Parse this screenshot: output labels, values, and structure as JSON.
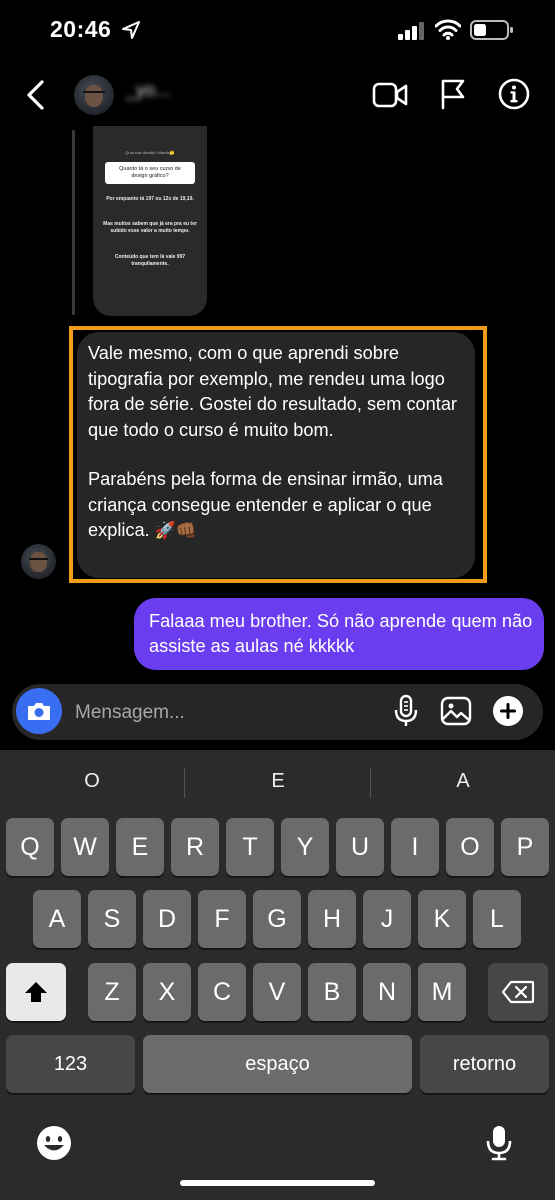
{
  "status_bar": {
    "time": "20:46"
  },
  "header": {
    "username": "_yo..."
  },
  "story_reply": {
    "title": "Qual sua dúvida? Manda🤔",
    "question": "Quanto tá o seu curso de design gráfico?",
    "answer_lines": [
      "Por enquanto tá 197 ou 12x de 19,19.",
      "Mas muitos sabem que já era pra eu ter subido esse valor a muito tempo.",
      "Conteúdo que tem lá vale 997 tranquilamente."
    ]
  },
  "messages": {
    "received_p1": "Vale mesmo, com o que aprendi sobre tipografia por exemplo, me rendeu uma logo fora de série. Gostei do resultado, sem contar que todo o curso é muito bom.",
    "received_p2": "Parabéns pela forma de ensinar irmão, uma criança consegue entender e aplicar o que explica.",
    "received_emoji": "🚀👊🏾",
    "sent": "Falaaa meu brother. Só não aprende quem não assiste as aulas né kkkkk"
  },
  "compose": {
    "placeholder": "Mensagem..."
  },
  "keyboard": {
    "suggestions": [
      "O",
      "E",
      "A"
    ],
    "row1": [
      "Q",
      "W",
      "E",
      "R",
      "T",
      "Y",
      "U",
      "I",
      "O",
      "P"
    ],
    "row2": [
      "A",
      "S",
      "D",
      "F",
      "G",
      "H",
      "J",
      "K",
      "L"
    ],
    "row3": [
      "Z",
      "X",
      "C",
      "V",
      "B",
      "N",
      "M"
    ],
    "numbers_label": "123",
    "space_label": "espaço",
    "return_label": "retorno"
  },
  "colors": {
    "accent": "#6a3ef0",
    "camera": "#3a6ef2",
    "highlight": "#f29b19"
  }
}
